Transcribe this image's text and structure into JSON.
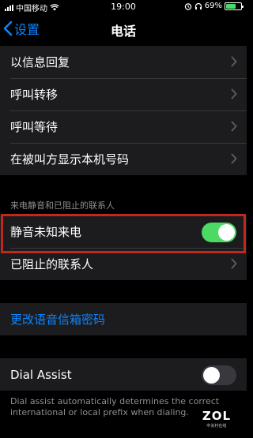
{
  "status_bar": {
    "carrier": "中国移动",
    "time": "19:00",
    "battery_percent": "69%",
    "battery_level": 0.69,
    "icons": [
      "signal-icon",
      "wifi-icon",
      "alarm-icon",
      "headphones-icon",
      "battery-icon"
    ]
  },
  "nav": {
    "back_label": "设置",
    "title": "电话"
  },
  "group1": {
    "items": [
      {
        "label": "以信息回复"
      },
      {
        "label": "呼叫转移"
      },
      {
        "label": "呼叫等待"
      },
      {
        "label": "在被叫方显示本机号码"
      }
    ]
  },
  "group2": {
    "header": "来电静音和已阻止的联系人",
    "silence_unknown": {
      "label": "静音未知来电",
      "on": true
    },
    "blocked": {
      "label": "已阻止的联系人"
    }
  },
  "voicemail": {
    "label": "更改语音信箱密码"
  },
  "dial_assist": {
    "label": "Dial Assist",
    "on": false,
    "footer": "Dial assist automatically determines the correct international or local prefix when dialing."
  },
  "watermark": {
    "logo": "ZOL",
    "sub": "中关村在线"
  },
  "colors": {
    "accent": "#0a84ff",
    "toggle_on": "#4cd964",
    "toggle_off": "#39393d",
    "highlight": "#c0281c",
    "cell_bg": "#1c1c1e"
  }
}
